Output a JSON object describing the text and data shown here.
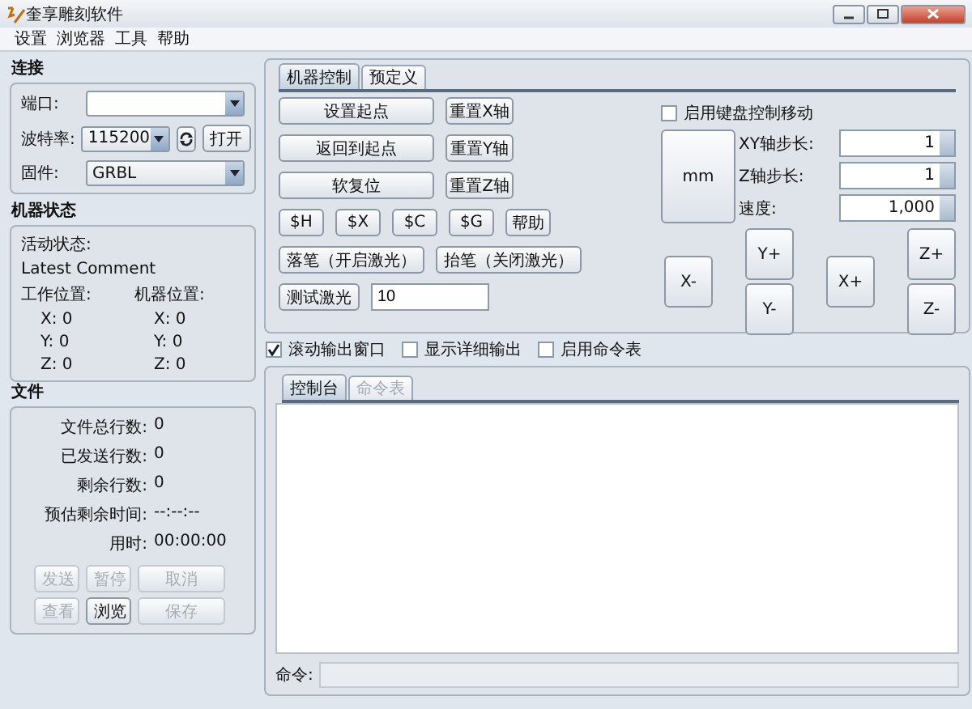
{
  "window": {
    "title": "奎享雕刻软件"
  },
  "menu": [
    "设置",
    "浏览器",
    "工具",
    "帮助"
  ],
  "connection": {
    "title": "连接",
    "port_label": "端口:",
    "baud_label": "波特率:",
    "baud_value": "115200",
    "open_button": "打开",
    "firmware_label": "固件:",
    "firmware_value": "GRBL"
  },
  "machine_status": {
    "title": "机器状态",
    "active_state_label": "活动状态:",
    "latest_comment": "Latest Comment",
    "work_position_label": "工作位置:",
    "machine_position_label": "机器位置:",
    "work_position": [
      "X: 0",
      "Y: 0",
      "Z: 0"
    ],
    "machine_position": [
      "X: 0",
      "Y: 0",
      "Z: 0"
    ]
  },
  "file": {
    "title": "文件",
    "stats": [
      {
        "label": "文件总行数:",
        "value": "0"
      },
      {
        "label": "已发送行数:",
        "value": "0"
      },
      {
        "label": "剩余行数:",
        "value": "0"
      },
      {
        "label": "预估剩余时间:",
        "value": "--:--:--"
      },
      {
        "label": "用时:",
        "value": "00:00:00"
      }
    ],
    "buttons": [
      {
        "label": "发送",
        "disabled": true
      },
      {
        "label": "暂停",
        "disabled": true
      },
      {
        "label": "取消",
        "disabled": true
      },
      {
        "label": "查看",
        "disabled": true
      },
      {
        "label": "浏览",
        "disabled": false
      },
      {
        "label": "保存",
        "disabled": true
      }
    ]
  },
  "control_tabs": [
    {
      "label": "机器控制",
      "selected": true
    },
    {
      "label": "预定义",
      "selected": false
    }
  ],
  "machine_control": {
    "rows": [
      [
        "设置起点",
        "重置X轴"
      ],
      [
        "返回到起点",
        "重置Y轴"
      ],
      [
        "软复位",
        "重置Z轴"
      ]
    ],
    "commands": [
      "$H",
      "$X",
      "$C",
      "$G",
      "帮助"
    ],
    "laser": [
      "落笔（开启激光）",
      "抬笔（关闭激光）"
    ],
    "test_laser": "测试激光",
    "test_value": "10"
  },
  "jog": {
    "keyboard": {
      "label": "启用键盘控制移动",
      "checked": false
    },
    "unit_button": "mm",
    "fields": [
      {
        "label": "XY轴步长:",
        "value": "1"
      },
      {
        "label": "Z轴步长:",
        "value": "1"
      },
      {
        "label": "速度:",
        "value": "1,000"
      }
    ],
    "buttons": {
      "x_minus": "X-",
      "y_plus": "Y+",
      "y_minus": "Y-",
      "x_plus": "X+",
      "z_plus": "Z+",
      "z_minus": "Z-"
    }
  },
  "options": [
    {
      "label": "滚动输出窗口",
      "checked": true
    },
    {
      "label": "显示详细输出",
      "checked": false
    },
    {
      "label": "启用命令表",
      "checked": false
    }
  ],
  "console_tabs": [
    {
      "label": "控制台",
      "selected": true
    },
    {
      "label": "命令表",
      "selected": false
    }
  ],
  "command": {
    "label": "命令:"
  }
}
